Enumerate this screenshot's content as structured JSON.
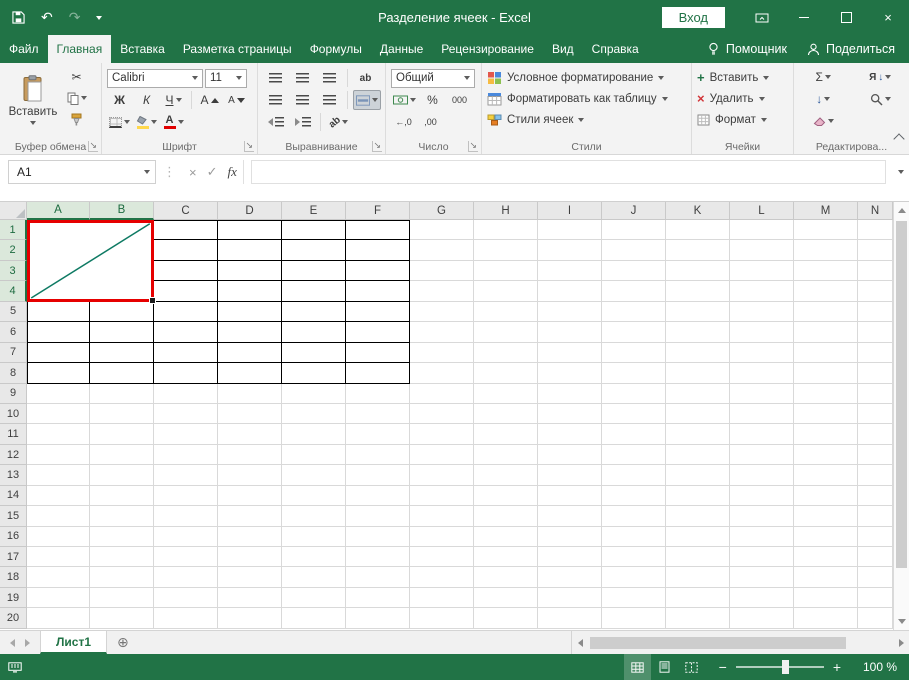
{
  "colors": {
    "brand_green": "#217346",
    "red_annotation": "#e60000",
    "diagonal_line": "#0e7a63",
    "fill_yellow": "#ffd84d",
    "font_color_red": "#e00000"
  },
  "titlebar": {
    "title": "Разделение ячеек  -  Excel",
    "sign_in": "Вход"
  },
  "menu": {
    "tabs": [
      {
        "label": "Файл",
        "active": false
      },
      {
        "label": "Главная",
        "active": true
      },
      {
        "label": "Вставка",
        "active": false
      },
      {
        "label": "Разметка страницы",
        "active": false
      },
      {
        "label": "Формулы",
        "active": false
      },
      {
        "label": "Данные",
        "active": false
      },
      {
        "label": "Рецензирование",
        "active": false
      },
      {
        "label": "Вид",
        "active": false
      },
      {
        "label": "Справка",
        "active": false
      }
    ],
    "assistant": "Помощник",
    "share": "Поделиться"
  },
  "ribbon": {
    "clipboard": {
      "label": "Буфер обмена",
      "paste": "Вставить"
    },
    "font": {
      "label": "Шрифт",
      "family": "Calibri",
      "size": "11",
      "bold": "Ж",
      "italic": "К",
      "underline": "Ч",
      "grow": "A",
      "shrink": "A"
    },
    "alignment": {
      "label": "Выравнивание",
      "wrap": "ab",
      "orientation": "ab"
    },
    "number": {
      "label": "Число",
      "format": "Общий",
      "percent": "%",
      "thousands": "000",
      "inc_decimal": "←,0",
      "dec_decimal": ",00"
    },
    "styles": {
      "label": "Стили",
      "conditional": "Условное форматирование",
      "format_table": "Форматировать как таблицу",
      "cell_styles": "Стили ячеек"
    },
    "cells": {
      "label": "Ячейки",
      "insert": "Вставить",
      "delete": "Удалить",
      "format": "Формат"
    },
    "editing": {
      "label": "Редактирова...",
      "autosum": "Σ",
      "sort": "Я",
      "fill": "↓"
    }
  },
  "formula_bar": {
    "name_box": "A1",
    "fx": "fx",
    "value": ""
  },
  "grid": {
    "columns": [
      "A",
      "B",
      "C",
      "D",
      "E",
      "F",
      "G",
      "H",
      "I",
      "J",
      "K",
      "L",
      "M",
      "N"
    ],
    "row_count": 20,
    "selected_columns": [
      "A",
      "B"
    ],
    "selected_rows": [
      1,
      2,
      3,
      4
    ],
    "bordered_cols": 6,
    "bordered_rows": 8,
    "merged_cols": 2,
    "merged_rows": 4
  },
  "sheet_tabs": {
    "active": "Лист1"
  },
  "status_bar": {
    "zoom_label": "100 %"
  },
  "icons": {
    "undo": "↶",
    "redo": "↷",
    "cut": "✂",
    "check": "✓",
    "cancel": "×",
    "dots": "⋮",
    "dialog_launcher": "↘",
    "new_sheet": "⊕",
    "close": "×",
    "plus": "+",
    "delete_cross": "×",
    "down": "↓"
  }
}
